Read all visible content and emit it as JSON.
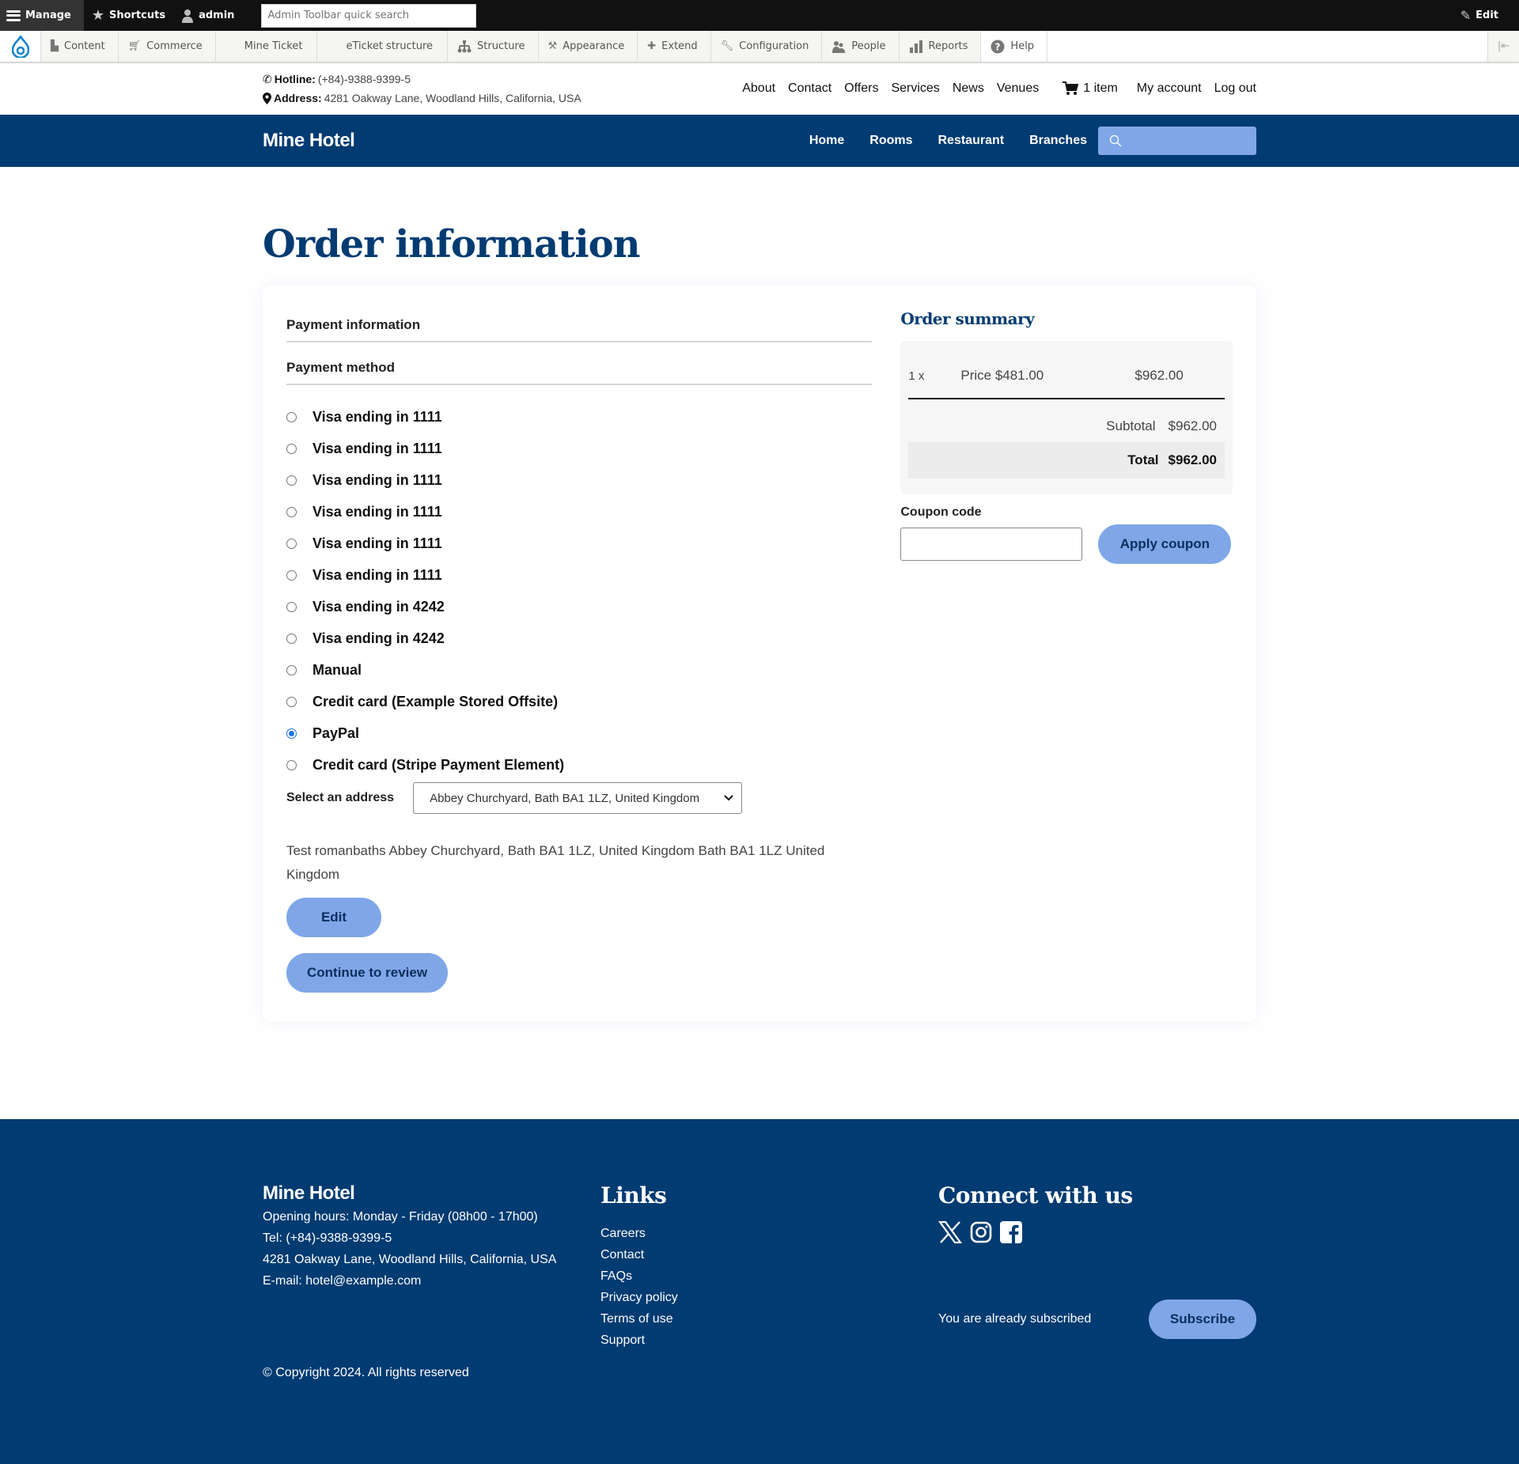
{
  "admin_toolbar": {
    "manage": "Manage",
    "shortcuts": "Shortcuts",
    "user": "admin",
    "quick_search_placeholder": "Admin Toolbar quick search",
    "edit": "Edit",
    "tray": [
      {
        "label": "Content",
        "icon": "file-icon"
      },
      {
        "label": "Commerce",
        "icon": "cart-icon"
      },
      {
        "label": "Mine Ticket",
        "icon": ""
      },
      {
        "label": "eTicket structure",
        "icon": ""
      },
      {
        "label": "Structure",
        "icon": "sitemap-icon"
      },
      {
        "label": "Appearance",
        "icon": "paintbrush-icon"
      },
      {
        "label": "Extend",
        "icon": "puzzle-icon"
      },
      {
        "label": "Configuration",
        "icon": "wrench-icon"
      },
      {
        "label": "People",
        "icon": "people-icon"
      },
      {
        "label": "Reports",
        "icon": "bar-chart-icon"
      },
      {
        "label": "Help",
        "icon": "help-icon"
      }
    ]
  },
  "site_header": {
    "hotline_label": "Hotline:",
    "hotline_value": "(+84)-9388-9399-5",
    "address_label": "Address:",
    "address_value": "4281 Oakway Lane, Woodland Hills, California, USA",
    "secondary_nav": [
      "About",
      "Contact",
      "Offers",
      "Services",
      "News",
      "Venues"
    ],
    "cart_label": "1 item",
    "my_account": "My account",
    "log_out": "Log out",
    "brand": "Mine Hotel",
    "main_nav": [
      "Home",
      "Rooms",
      "Restaurant",
      "Branches"
    ],
    "search_placeholder": ""
  },
  "page": {
    "title": "Order information",
    "payment_information_heading": "Payment information",
    "payment_method_heading": "Payment method",
    "payment_methods": [
      {
        "label": "Visa ending in 1111",
        "checked": false
      },
      {
        "label": "Visa ending in 1111",
        "checked": false
      },
      {
        "label": "Visa ending in 1111",
        "checked": false
      },
      {
        "label": "Visa ending in 1111",
        "checked": false
      },
      {
        "label": "Visa ending in 1111",
        "checked": false
      },
      {
        "label": "Visa ending in 1111",
        "checked": false
      },
      {
        "label": "Visa ending in 4242",
        "checked": false
      },
      {
        "label": "Visa ending in 4242",
        "checked": false
      },
      {
        "label": "Manual",
        "checked": false
      },
      {
        "label": "Credit card (Example Stored Offsite)",
        "checked": false
      },
      {
        "label": "PayPal",
        "checked": true
      },
      {
        "label": "Credit card (Stripe Payment Element)",
        "checked": false
      }
    ],
    "select_address_label": "Select an address",
    "select_address_value": "Abbey Churchyard, Bath BA1 1LZ, United Kingdom",
    "address_text": "Test romanbaths Abbey Churchyard, Bath BA1 1LZ, United Kingdom Bath BA1 1LZ United Kingdom",
    "edit_button": "Edit",
    "continue_button": "Continue to review"
  },
  "order_summary": {
    "title": "Order summary",
    "line_items": [
      {
        "qty": "1 x",
        "price": "Price $481.00",
        "total": "$962.00"
      }
    ],
    "subtotal_label": "Subtotal",
    "subtotal_value": "$962.00",
    "total_label": "Total",
    "total_value": "$962.00",
    "coupon_label": "Coupon code",
    "coupon_value": "",
    "apply_coupon_button": "Apply coupon"
  },
  "footer": {
    "brand": "Mine Hotel",
    "opening_hours": "Opening hours: Monday - Friday (08h00 - 17h00)",
    "tel": "Tel: (+84)-9388-9399-5",
    "address": "4281 Oakway Lane, Woodland Hills, California, USA",
    "email": "E-mail: hotel@example.com",
    "copyright": "© Copyright 2024. All rights reserved",
    "links_heading": "Links",
    "links": [
      "Careers",
      "Contact",
      "FAQs",
      "Privacy policy",
      "Terms of use",
      "Support"
    ],
    "connect_heading": "Connect with us",
    "social": [
      "x-icon",
      "instagram-icon",
      "facebook-icon"
    ],
    "subscribed_message": "You are already subscribed",
    "subscribe_button": "Subscribe"
  },
  "colors": {
    "brand_navy": "#003b71",
    "button_blue": "#7fa7e8",
    "radio_checked": "#1a73e8"
  }
}
